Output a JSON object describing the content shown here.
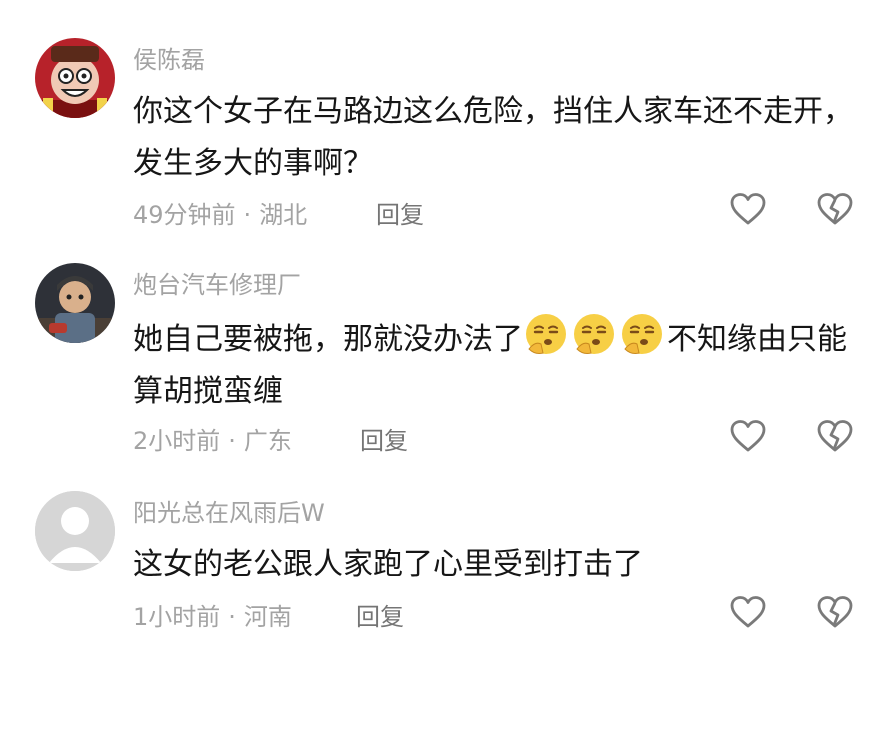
{
  "comments": [
    {
      "username": "侯陈磊",
      "text": "你这个女子在马路边这么危险，挡住人家车还不走开，发生多大的事啊？",
      "time": "49分钟前",
      "location": "湖北",
      "reply_label": "回复"
    },
    {
      "username": "炮台汽车修理厂",
      "text_before": "她自己要被拖，那就没办法了",
      "emojis": [
        "thinking-face-emoji",
        "thinking-face-emoji",
        "thinking-face-emoji"
      ],
      "text_after": "不知缘由只能算胡搅蛮缠",
      "time": "2小时前",
      "location": "广东",
      "reply_label": "回复"
    },
    {
      "username": "阳光总在风雨后W",
      "text": "这女的老公跟人家跑了心里受到打击了",
      "time": "1小时前",
      "location": "河南",
      "reply_label": "回复"
    }
  ],
  "separator": "·",
  "colors": {
    "username": "#a3a3a3",
    "body_text": "#161616",
    "meta": "#a3a3a3",
    "reply": "#757575",
    "icon_stroke": "#7a7a7a",
    "emoji_face": "#f7cf45"
  }
}
